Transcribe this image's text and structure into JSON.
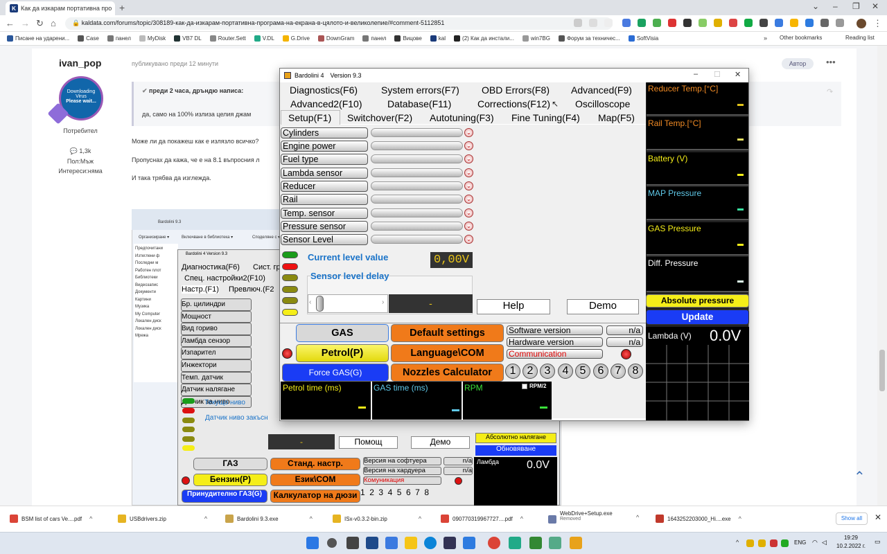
{
  "browser": {
    "tab_title": "Как да изкарам портативна про",
    "url": "kaldata.com/forums/topic/308189-как-да-изкарам-портативна-програма-на-екрана-в-цялото-и-великолепие/#comment-5112851",
    "bookmarks": [
      "Писане на ударени...",
      "Case",
      "панел",
      "MyDisk",
      "VB7 DL",
      "Router.Sett",
      "V.DL",
      "G.Drive",
      "DownGram",
      "панел",
      "Вицове",
      "kal",
      "(2) Как да инстали...",
      "win7BG",
      "Форум за техничес...",
      "SoftVisia"
    ],
    "other_bookmarks": "Other bookmarks",
    "reading_list": "Reading list"
  },
  "post": {
    "author": "ivan_pop",
    "posted": "публикувано преди 12 минути",
    "author_badge": "Автор",
    "avatar_line1": "Downloading Virus",
    "avatar_line2": "Please wait...",
    "role": "Потребител",
    "count": "1,3k",
    "gender": "Пол:Мъж",
    "interests": "Интереси:няма",
    "quote_header": "преди 2 часа, дръндю написа:",
    "quote_text": "да, само на 100% излиза целия джам",
    "text1": "Може ли да покажеш как е излязло всичко?",
    "text2": "Пропуснах да кажа, че е на 8.1 въпросния л",
    "text3": "И така трябва да изглежда."
  },
  "shot": {
    "crumb": "Bardolini 9.3",
    "org": "Организиране ▾",
    "lib": "Включване в библиотека ▾",
    "share": "Споделяне с ▾",
    "side": [
      "Предпочитани",
      "Изтеглени ф",
      "Последни м",
      "Работен плот",
      "",
      "Библиотеки",
      "Видеозапис",
      "Документи",
      "Картини",
      "Музика",
      "",
      "My Computer",
      "Локален диск",
      "Локален диск",
      "",
      "Мрежа"
    ],
    "app_title": "Bardolini 4   Version 9.3",
    "tabs1": "Диагностика(F6)",
    "tabs1b": "Сист. гр",
    "tabs2": "Спец. настройки2(F10)",
    "tabs3a": "Настр.(F1)",
    "tabs3b": "Превлюч.(F2",
    "rows": [
      "Бр. цилиндри",
      "Мощност",
      "Вид гориво",
      "Ламбда сензор",
      "Изпарител",
      "Инжектори",
      "Темп. датчик",
      "Датчик налягане",
      "Датчик за ниво"
    ],
    "cur_level": "Текущо ниво",
    "delay": "Датчик ниво закъсн",
    "help": "Помощ",
    "demo": "Демо",
    "abs": "Абсолютно налягане",
    "update": "Обновяване",
    "lambda": "Ламбда",
    "lambda_val": "0.0V",
    "gas": "ГАЗ",
    "defaults": "Станд. настр.",
    "petrol": "Бензин(P)",
    "lang": "Език\\COM",
    "force": "Принудително ГАЗ(G)",
    "nozzles": "Калкулатор на дюзи",
    "sw": "Версия на софтуера",
    "hw": "Версия на хардуера",
    "comm": "Комуникация",
    "na": "n/a",
    "dash": "-"
  },
  "app": {
    "title": "Bardolini 4",
    "version": "Version 9.3",
    "tabs_row1": [
      "Diagnostics(F6)",
      "System errors(F7)",
      "OBD Errors(F8)",
      "Advanced(F9)"
    ],
    "tabs_row2": [
      "Advanced2(F10)",
      "Database(F11)",
      "Corrections(F12)",
      "Oscilloscope"
    ],
    "tabs_row3": [
      "Setup(F1)",
      "Switchover(F2)",
      "Autotuning(F3)",
      "Fine Tuning(F4)",
      "Map(F5)"
    ],
    "setup_rows": [
      "Cylinders",
      "Engine power",
      "Fuel type",
      "Lambda sensor",
      "Reducer",
      "Rail",
      "Temp. sensor",
      "Pressure sensor",
      "Sensor Level"
    ],
    "current_level_label": "Current level value",
    "current_level_value": "0,00V",
    "sensor_delay_label": "Sensor level delay",
    "sensor_delay_value": "-",
    "help": "Help",
    "demo": "Demo",
    "gas": "GAS",
    "default_settings": "Default settings",
    "petrol": "Petrol(P)",
    "language": "Language\\COM",
    "force_gas": "Force GAS(G)",
    "nozzles": "Nozzles Calculator",
    "software_version": "Software version",
    "hardware_version": "Hardware version",
    "communication": "Communication",
    "na": "n/a",
    "cylinders": [
      "1",
      "2",
      "3",
      "4",
      "5",
      "6",
      "7",
      "8"
    ],
    "petrol_time": "Petrol time (ms)",
    "gas_time": "GAS time (ms)",
    "rpm": "RPM",
    "rpm2": "RPM/2",
    "right_panels": [
      {
        "label": "Reducer Temp.[°C]",
        "color": "#f08a24"
      },
      {
        "label": "Rail Temp.[°C]",
        "color": "#f08a24"
      },
      {
        "label": "Battery (V)",
        "color": "#f5ee18"
      },
      {
        "label": "MAP Pressure",
        "color": "#5fc8e8"
      },
      {
        "label": "GAS Pressure",
        "color": "#f5ee18"
      },
      {
        "label": "Diff. Pressure",
        "color": "#ffffff"
      }
    ],
    "absolute_pressure": "Absolute pressure",
    "update": "Update",
    "lambda_label": "Lambda (V)",
    "lambda_value": "0.0V"
  },
  "downloads": [
    {
      "name": "BSM list of cars Ve....pdf",
      "color": "#db4437"
    },
    {
      "name": "USBdrivers.zip",
      "color": "#e6b422"
    },
    {
      "name": "Bardolini 9.3.exe",
      "color": "#c9a44a"
    },
    {
      "name": "ISx-v0.3.2-bin.zip",
      "color": "#e6b422"
    },
    {
      "name": "090770319967727....pdf",
      "color": "#db4437"
    },
    {
      "name": "WebDrive+Setup.exe",
      "status": "Removed",
      "color": "#6a7aa8"
    },
    {
      "name": "1643252203000_Hi....exe",
      "color": "#c0392b"
    }
  ],
  "show_all": "Show all",
  "taskbar": {
    "lang": "ENG",
    "time": "19:29",
    "date": "10.2.2022 г."
  }
}
